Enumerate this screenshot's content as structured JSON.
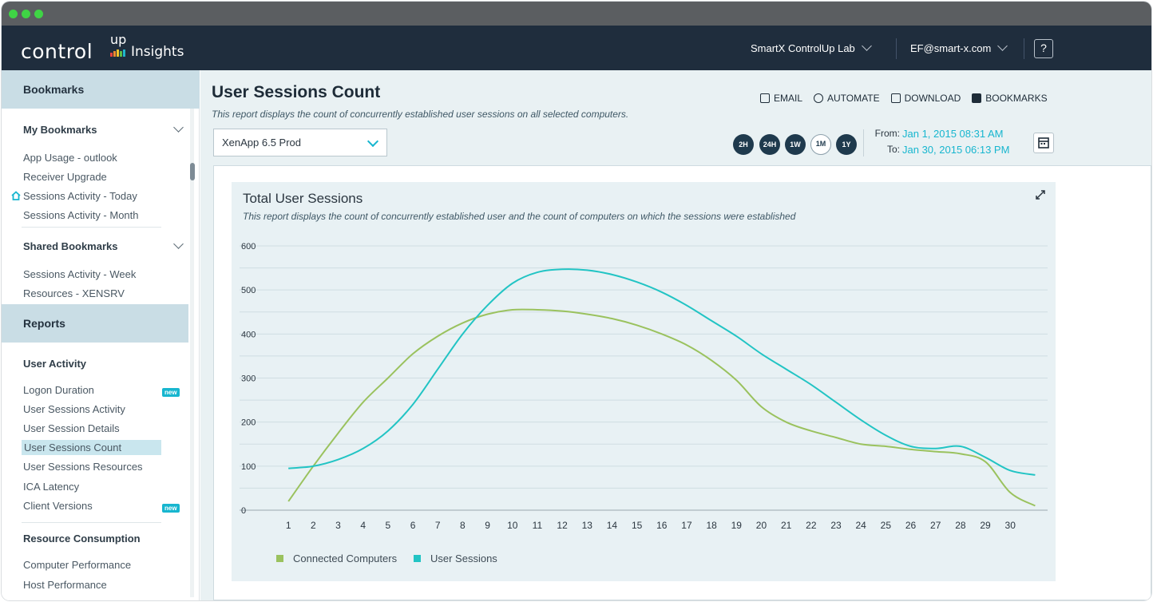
{
  "window": {
    "dots": [
      "#3fd445",
      "#3fd445",
      "#3fd445"
    ]
  },
  "header": {
    "logo": {
      "word1": "control",
      "word2": "up",
      "word3": "Insights"
    },
    "org": "SmartX ControlUp Lab",
    "user": "EF@smart-x.com",
    "help": "?"
  },
  "sidebar": {
    "bookmarks_title": "Bookmarks",
    "my_bookmarks_title": "My Bookmarks",
    "my_bookmarks": [
      "App Usage - outlook",
      "Receiver Upgrade",
      "Sessions Activity - Today",
      "Sessions Activity - Month"
    ],
    "shared_bookmarks_title": "Shared Bookmarks",
    "shared_bookmarks": [
      "Sessions Activity - Week",
      "Resources - XENSRV"
    ],
    "reports_title": "Reports",
    "user_activity_title": "User Activity",
    "user_activity": [
      "Logon Duration",
      "User Sessions Activity",
      "User Session Details",
      "User Sessions Count",
      "User Sessions Resources",
      "ICA Latency",
      "Client Versions"
    ],
    "new_badge": "new",
    "resource_title": "Resource Consumption",
    "resource": [
      "Computer Performance",
      "Host Performance"
    ]
  },
  "main": {
    "title": "User Sessions Count",
    "description": "This report displays the count of concurrently established user sessions on all selected computers.",
    "actions": {
      "email": "EMAIL",
      "automate": "AUTOMATE",
      "download": "DOWNLOAD",
      "bookmarks": "BOOKMARKS"
    },
    "selector": "XenApp 6.5 Prod",
    "ranges": [
      "2H",
      "24H",
      "1W",
      "1M",
      "1Y"
    ],
    "from_label": "From:",
    "from_value": "Jan  1,  2015 08:31 AM",
    "to_label": "To:",
    "to_value": "Jan 30,  2015 06:13 PM"
  },
  "chart_data": {
    "type": "line",
    "title": "Total User Sessions",
    "subtitle": "This report displays the count of concurrently established user and the count of computers on which the sessions were established",
    "x": [
      1,
      2,
      3,
      4,
      5,
      6,
      7,
      8,
      9,
      10,
      11,
      12,
      13,
      14,
      15,
      16,
      17,
      18,
      19,
      20,
      21,
      22,
      23,
      24,
      25,
      26,
      27,
      28,
      29,
      30,
      31
    ],
    "x_tick_labels": [
      "1",
      "2",
      "3",
      "4",
      "5",
      "6",
      "7",
      "8",
      "9",
      "10",
      "11",
      "12",
      "13",
      "14",
      "15",
      "16",
      "17",
      "18",
      "19",
      "20",
      "21",
      "22",
      "23",
      "24",
      "25",
      "26",
      "27",
      "28",
      "29",
      "30"
    ],
    "ylim": [
      0,
      600
    ],
    "y_ticks": [
      0,
      100,
      200,
      300,
      400,
      500,
      600
    ],
    "grid": true,
    "legend_placement": "bottom-left",
    "series": [
      {
        "name": "Connected Computers",
        "color": "#9ac25e",
        "values": [
          20,
          100,
          175,
          245,
          300,
          355,
          395,
          425,
          445,
          455,
          455,
          452,
          445,
          435,
          420,
          400,
          375,
          340,
          295,
          235,
          200,
          180,
          165,
          150,
          145,
          138,
          133,
          128,
          110,
          40,
          10
        ]
      },
      {
        "name": "User Sessions",
        "color": "#22c4c4",
        "values": [
          95,
          100,
          115,
          140,
          180,
          240,
          320,
          400,
          465,
          515,
          540,
          547,
          545,
          535,
          518,
          495,
          465,
          430,
          395,
          355,
          320,
          285,
          245,
          205,
          170,
          145,
          140,
          145,
          120,
          90,
          80
        ]
      }
    ]
  }
}
